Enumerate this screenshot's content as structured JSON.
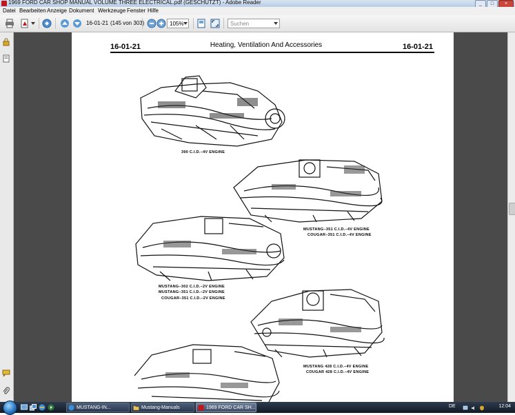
{
  "window": {
    "title": "1969 FORD CAR SHOP MANUAL VOLUME THREE ELECTRICAL.pdf (GESCHÜTZT) - Adobe Reader",
    "minimize": "_",
    "maximize": "□",
    "close": "×"
  },
  "menu": [
    "Datei",
    "Bearbeiten",
    "Anzeige",
    "Dokument",
    "Werkzeuge",
    "Fenster",
    "Hilfe"
  ],
  "toolbar": {
    "page_field": "16-01-21",
    "page_count": "(145 von 303)",
    "zoom": "105%",
    "search_placeholder": "Suchen"
  },
  "document": {
    "page_number_left": "16-01-21",
    "page_title": "Heating, Ventilation And Accessories",
    "page_number_right": "16-01-21",
    "captions": {
      "engine_390": "390 C.I.D.–4V ENGINE",
      "mustang_351_4v": "MUSTANG–351 C.I.D.–4V ENGINE",
      "cougar_351_4v": "COUGAR–351 C.I.D.–4V ENGINE",
      "mustang_302_2v": "MUSTANG–302 C.I.D.–2V ENGINE",
      "mustang_351_2v": "MUSTANG–351 C.I.D.–2V ENGINE",
      "cougar_351_2v": "COUGAR–351 C.I.D.–2V ENGINE",
      "mustang_428_4v": "MUSTANG 428 C.I.D.–4V ENGINE",
      "cougar_428_4v": "COUGAR 428 C.I.D.–4V ENGINE"
    }
  },
  "taskbar": {
    "tasks": [
      "MUSTANG-IN...",
      "Mustang-Manuals",
      "1969 FORD CAR SH..."
    ],
    "language": "DE",
    "clock": "12:04"
  }
}
